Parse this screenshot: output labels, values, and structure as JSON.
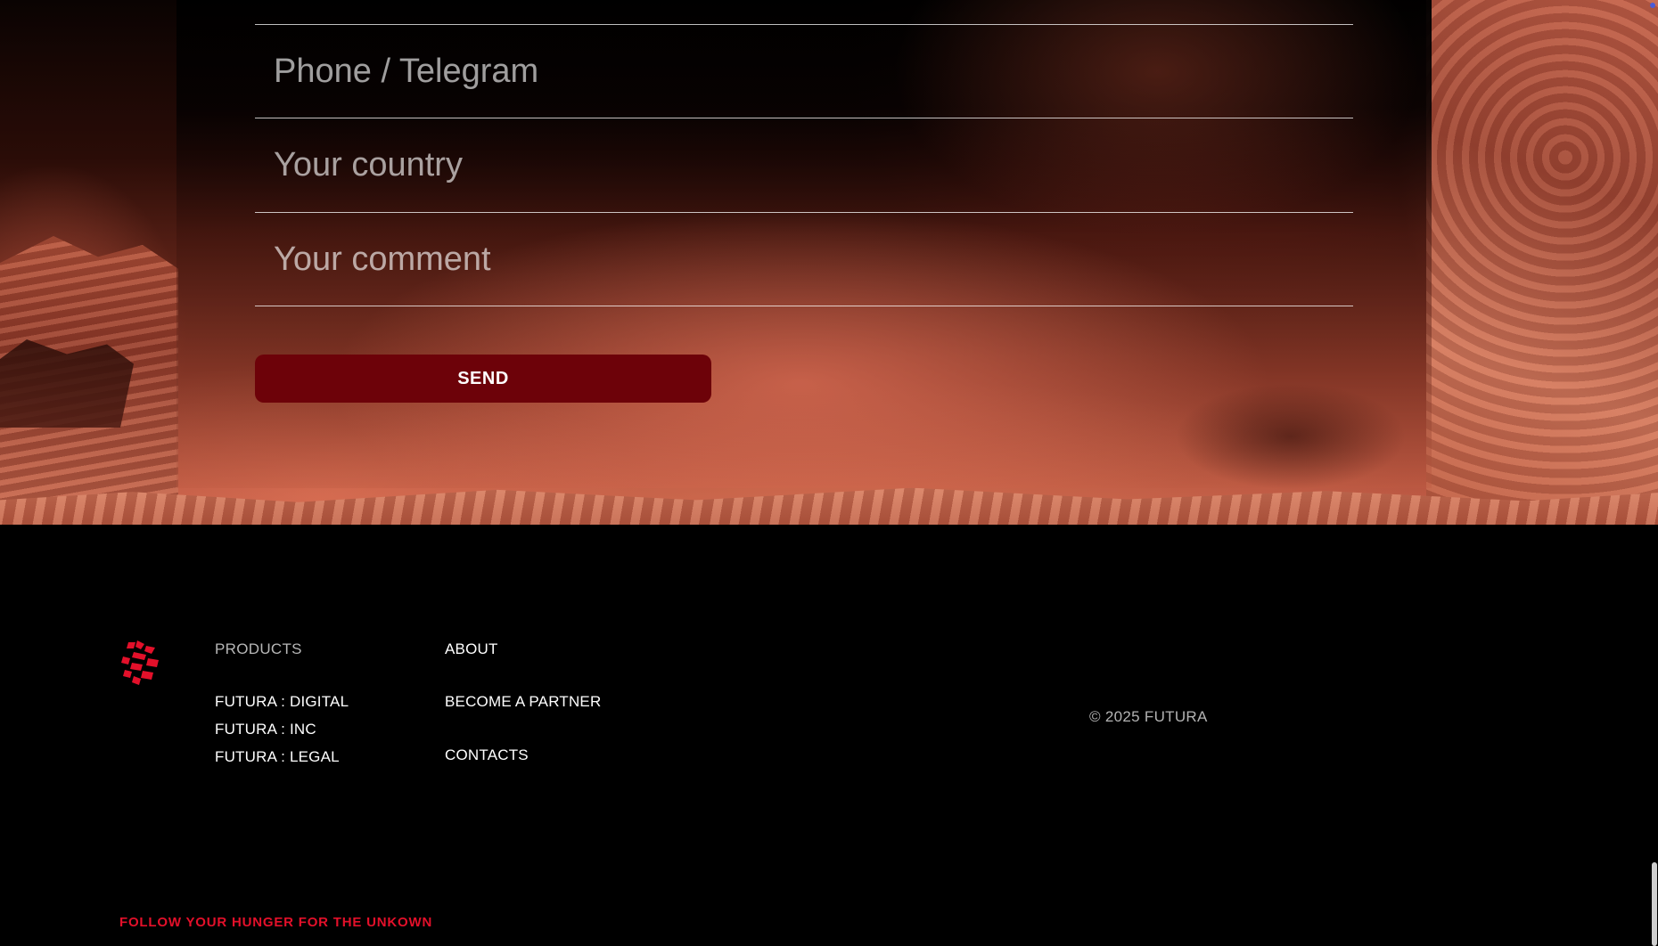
{
  "form": {
    "phone_placeholder": "Phone / Telegram",
    "country_placeholder": "Your country",
    "comment_placeholder": "Your comment",
    "send_label": "SEND"
  },
  "footer": {
    "logo_icon": "futura-logo-icon",
    "products_heading": "PRODUCTS",
    "products": [
      "FUTURA : DIGITAL",
      "FUTURA : INC",
      "FUTURA : LEGAL"
    ],
    "links": {
      "about": "ABOUT",
      "become_partner": "BECOME A PARTNER",
      "contacts": "CONTACTS"
    },
    "copyright": "© 2025 FUTURA",
    "tagline": "FOLLOW YOUR HUNGER FOR THE UNKOWN"
  },
  "colors": {
    "accent": "#6d0209",
    "brand_red": "#e3102a",
    "background": "#000000"
  }
}
